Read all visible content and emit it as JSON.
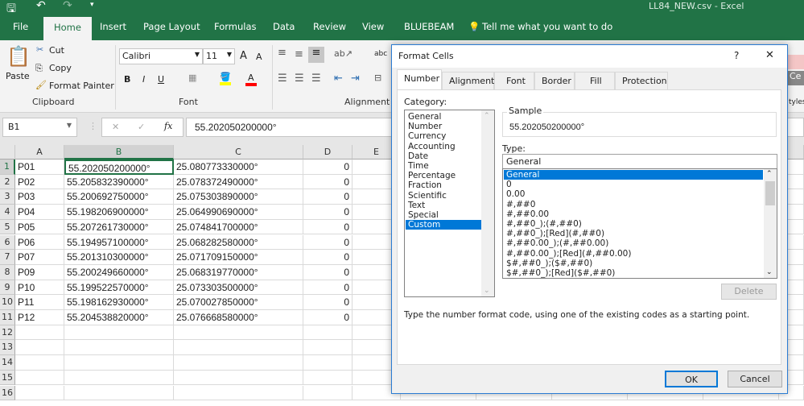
{
  "window": {
    "title": "LL84_NEW.csv  -  Excel"
  },
  "ribbon": {
    "tabs": [
      "File",
      "Home",
      "Insert",
      "Page Layout",
      "Formulas",
      "Data",
      "Review",
      "View",
      "BLUEBEAM"
    ],
    "active_tab": "Home",
    "tell_me": "Tell me what you want to do",
    "clipboard": {
      "paste": "Paste",
      "cut": "Cut",
      "copy": "Copy",
      "format_painter": "Format Painter",
      "label": "Clipboard"
    },
    "font": {
      "name": "Calibri",
      "size": "11",
      "bold": "B",
      "italic": "I",
      "underline": "U",
      "grow": "A",
      "shrink": "A",
      "label": "Font",
      "fill_color": "#ffff00",
      "font_color": "#ff0000"
    },
    "alignment": {
      "label": "Alignment"
    },
    "styles_partial": "tyles",
    "cell_styles_partial": "Ce"
  },
  "formula_bar": {
    "name_box": "B1",
    "fx": "fx",
    "value": "55.202050200000°"
  },
  "sheet": {
    "columns": [
      "A",
      "B",
      "C",
      "D",
      "E"
    ],
    "row_numbers": [
      "1",
      "2",
      "3",
      "4",
      "5",
      "6",
      "7",
      "8",
      "9",
      "10",
      "11",
      "12",
      "13",
      "14",
      "15",
      "16"
    ],
    "selected_cell": "B1",
    "rows": [
      [
        "P01",
        "55.202050200000°",
        "25.080773330000°",
        "0"
      ],
      [
        "P02",
        "55.205832390000°",
        "25.078372490000°",
        "0"
      ],
      [
        "P03",
        "55.200692750000°",
        "25.075303890000°",
        "0"
      ],
      [
        "P04",
        "55.198206900000°",
        "25.064990690000°",
        "0"
      ],
      [
        "P05",
        "55.207261730000°",
        "25.074841700000°",
        "0"
      ],
      [
        "P06",
        "55.194957100000°",
        "25.068282580000°",
        "0"
      ],
      [
        "P07",
        "55.201310300000°",
        "25.071709150000°",
        "0"
      ],
      [
        "P09",
        "55.200249660000°",
        "25.068319770000°",
        "0"
      ],
      [
        "P10",
        "55.199522570000°",
        "25.073303500000°",
        "0"
      ],
      [
        "P11",
        "55.198162930000°",
        "25.070027850000°",
        "0"
      ],
      [
        "P12",
        "55.204538820000°",
        "25.076668580000°",
        "0"
      ]
    ]
  },
  "dialog": {
    "title": "Format Cells",
    "help": "?",
    "close": "✕",
    "tabs": [
      "Number",
      "Alignment",
      "Font",
      "Border",
      "Fill",
      "Protection"
    ],
    "active_tab": "Number",
    "category_label": "Category:",
    "categories": [
      "General",
      "Number",
      "Currency",
      "Accounting",
      "Date",
      "Time",
      "Percentage",
      "Fraction",
      "Scientific",
      "Text",
      "Special",
      "Custom"
    ],
    "selected_category": "Custom",
    "sample_label": "Sample",
    "sample_value": "55.202050200000°",
    "type_label": "Type:",
    "type_value": "General",
    "type_list": [
      "General",
      "0",
      "0.00",
      "#,##0",
      "#,##0.00",
      "#,##0_);(#,##0)",
      "#,##0_);[Red](#,##0)",
      "#,##0.00_);(#,##0.00)",
      "#,##0.00_);[Red](#,##0.00)",
      "$#,##0_);($#,##0)",
      "$#,##0_);[Red]($#,##0)"
    ],
    "selected_type": "General",
    "delete": "Delete",
    "description": "Type the number format code, using one of the existing codes as a starting point.",
    "ok": "OK",
    "cancel": "Cancel"
  }
}
